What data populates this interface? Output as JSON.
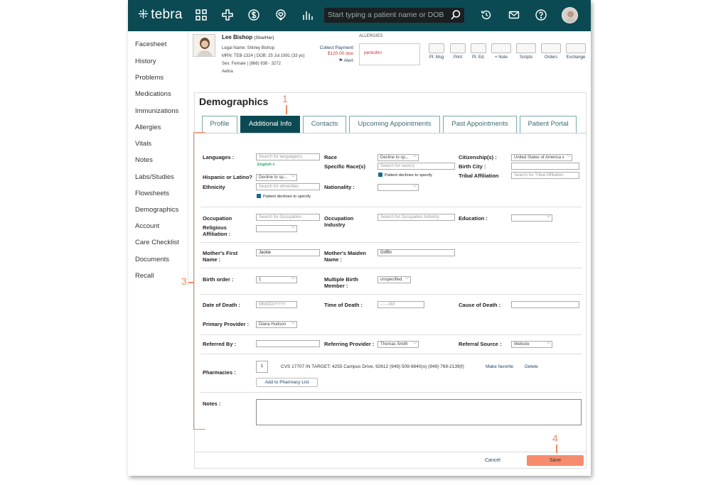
{
  "app": {
    "logo_text": "tebra",
    "search_placeholder": "Start typing a patient name or DOB"
  },
  "sidenav": {
    "items": [
      "Facesheet",
      "History",
      "Problems",
      "Medications",
      "Immunizations",
      "Allergies",
      "Vitals",
      "Notes",
      "Labs/Studies",
      "Flowsheets",
      "Demographics",
      "Account",
      "Care Checklist",
      "Documents",
      "Recall"
    ]
  },
  "patient": {
    "name": "Lee Bishop",
    "pronouns": "(She/Her)",
    "legal_name": "Legal Name: Shirley Bishop",
    "mrn_dob": "MRN: TEB-1324 | DOB: 25 Jul 1991 (33 yo)",
    "sex_phone": "Sex: Female | (866) 938 - 3272",
    "insurance": "Aetna",
    "collect_payment": "Collect Payment",
    "due": "$120.00 due",
    "alert": "Alert",
    "allergies_heading": "ALLERGIES",
    "allergy": "penicillin"
  },
  "toolbar": {
    "items": [
      "Pt. Msg",
      "Print",
      "Pt. Ed.",
      "+ Note",
      "Scripts",
      "Orders",
      "Exchange"
    ]
  },
  "page": {
    "title": "Demographics",
    "tabs": [
      "Profile",
      "Additional Info",
      "Contacts",
      "Upcoming Appointments",
      "Past Appointments",
      "Patient Portal"
    ],
    "active_tab": "Additional Info"
  },
  "form": {
    "languages_label": "Languages :",
    "languages_placeholder": "Search for language(s)",
    "languages_tag": "English  x",
    "race_label": "Race",
    "race_value": "Decline to sp...",
    "specific_race_label": "Specific Race(s)",
    "specific_race_placeholder": "Search for race(s)",
    "race_decline_check": "Patient declines to specify",
    "citizenship_label": "Citizenship(s) :",
    "citizenship_value": "United States of America  x",
    "birth_city_label": "Birth City :",
    "tribal_label": "Tribal Affiliation",
    "tribal_placeholder": "Search for Tribal Affiliation",
    "hispanic_label": "Hispanic or Latino?",
    "hispanic_value": "Decline to sp...",
    "ethnicity_label": "Ethnicity",
    "ethnicity_placeholder": "Search for ethnicities",
    "ethnicity_decline_check": "Patient declines to specify",
    "nationality_label": "Nationality :",
    "occupation_label": "Occupation",
    "occupation_placeholder": "Search for Occupation",
    "occupation_industry_label": "Occupation Industry",
    "occupation_industry_placeholder": "Search for Occupation Industry",
    "education_label": "Education :",
    "religious_label": "Religious Affiliation :",
    "mother_first_label": "Mother's First Name :",
    "mother_first_value": "Jackie",
    "mother_maiden_label": "Mother's Maiden Name :",
    "mother_maiden_value": "Griffin",
    "birth_order_label": "Birth order :",
    "birth_order_value": "1",
    "multiple_birth_label": "Multiple Birth Member :",
    "multiple_birth_value": "unspecified",
    "dod_label": "Date of Death :",
    "dod_placeholder": "MM/DD/YYYY",
    "tod_label": "Time of Death :",
    "tod_placeholder": "--:-- AM",
    "cause_label": "Cause of Death :",
    "primary_provider_label": "Primary Provider :",
    "primary_provider_value": "Diana Hudson",
    "referred_by_label": "Referred By :",
    "referring_provider_label": "Referring Provider :",
    "referring_provider_value": "Thomas Smith",
    "referral_source_label": "Referral Source :",
    "referral_source_value": "Website",
    "pharmacies_label": "Pharmacies :",
    "pharmacy_number": "1",
    "pharmacy_text": "CVS 17707 IN TARGET: 4255 Campus Drive, 92612  (949) 509-9840(o)  (949) 769-2139(f)",
    "make_favorite": "Make favorite",
    "delete": "Delete",
    "add_pharmacy": "Add to Pharmacy List",
    "notes_label": "Notes :"
  },
  "footer": {
    "cancel": "Cancel",
    "save": "Save"
  },
  "annotations": {
    "one": "1",
    "three": "3",
    "four": "4"
  },
  "colors": {
    "topbar": "#0b4a53",
    "annotation": "#f28a5f",
    "save_button": "#f58c6e"
  }
}
